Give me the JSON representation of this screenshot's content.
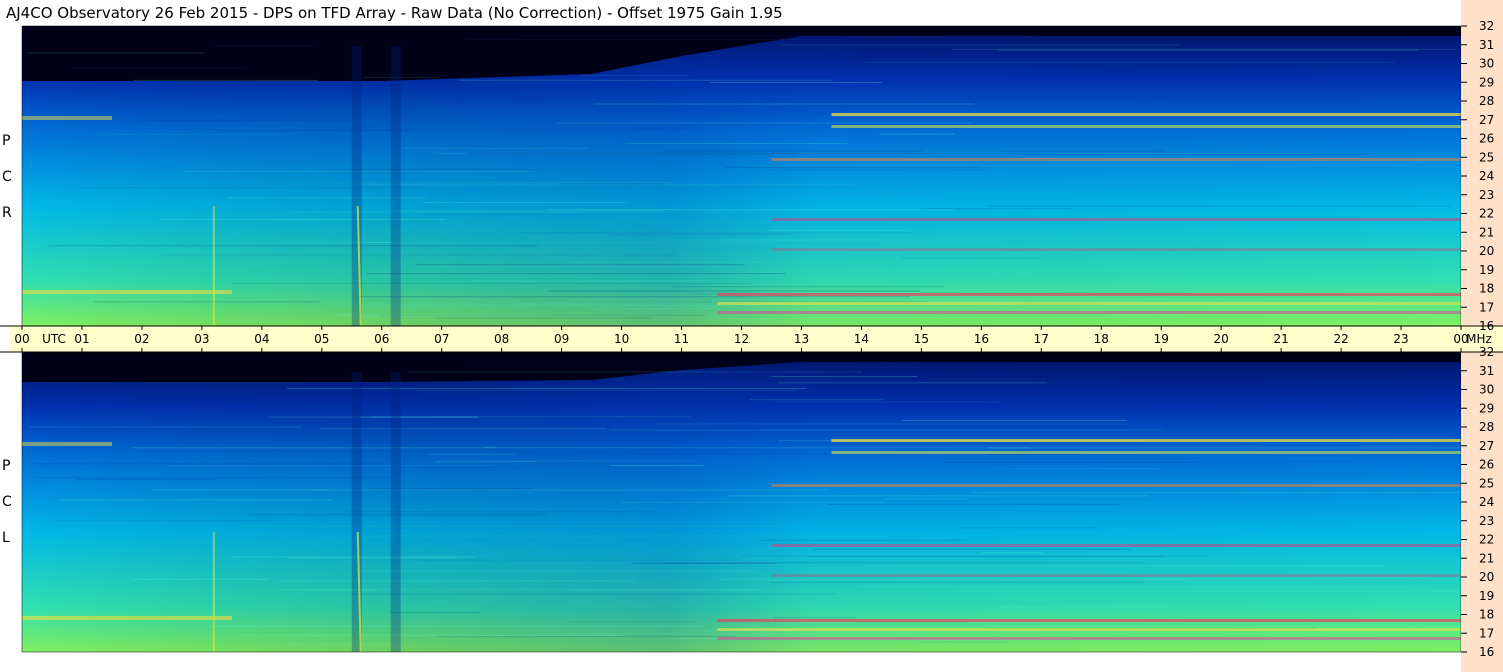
{
  "title": "AJ4CO Observatory  26 Feb 2015  -  DPS on TFD Array  -  Raw Data (No Correction)  -  Offset 1975  Gain 1.95",
  "panels": [
    {
      "id": "rcp",
      "label": [
        "R",
        "C",
        "P"
      ]
    },
    {
      "id": "lcp",
      "label": [
        "L",
        "C",
        "P"
      ]
    }
  ],
  "time_axis": {
    "labels": [
      "00",
      "UTC",
      "01",
      "02",
      "03",
      "04",
      "05",
      "06",
      "07",
      "08",
      "09",
      "10",
      "11",
      "12",
      "13",
      "14",
      "15",
      "16",
      "17",
      "18",
      "19",
      "20",
      "21",
      "22",
      "23",
      "00",
      "MHz"
    ]
  },
  "freq_axis": {
    "labels": [
      "32",
      "31",
      "30",
      "29",
      "28",
      "27",
      "26",
      "25",
      "24",
      "23",
      "22",
      "21",
      "20",
      "19",
      "18",
      "17",
      "16"
    ]
  },
  "colors": {
    "axis_bg": "#ffffcc",
    "right_strip": "#ffe0c8",
    "background_low": "#00c0e0",
    "background_high": "#0040c0",
    "no_data": "#000020"
  },
  "chart_data": {
    "type": "heatmap",
    "title": "AJ4CO Observatory  26 Feb 2015  -  DPS on TFD Array  -  Raw Data (No Correction)  -  Offset 1975  Gain 1.95",
    "xlabel": "UTC",
    "ylabel": "MHz",
    "xlim": [
      0,
      24
    ],
    "ylim": [
      16,
      32
    ],
    "x": [
      0,
      1,
      2,
      3,
      4,
      5,
      6,
      7,
      8,
      9,
      10,
      11,
      12,
      13,
      14,
      15,
      16,
      17,
      18,
      19,
      20,
      21,
      22,
      23,
      24
    ],
    "y": [
      16,
      17,
      18,
      19,
      20,
      21,
      22,
      23,
      24,
      25,
      26,
      27,
      28,
      29,
      30,
      31,
      32
    ],
    "series": [
      {
        "name": "RCP"
      },
      {
        "name": "LCP"
      }
    ]
  }
}
